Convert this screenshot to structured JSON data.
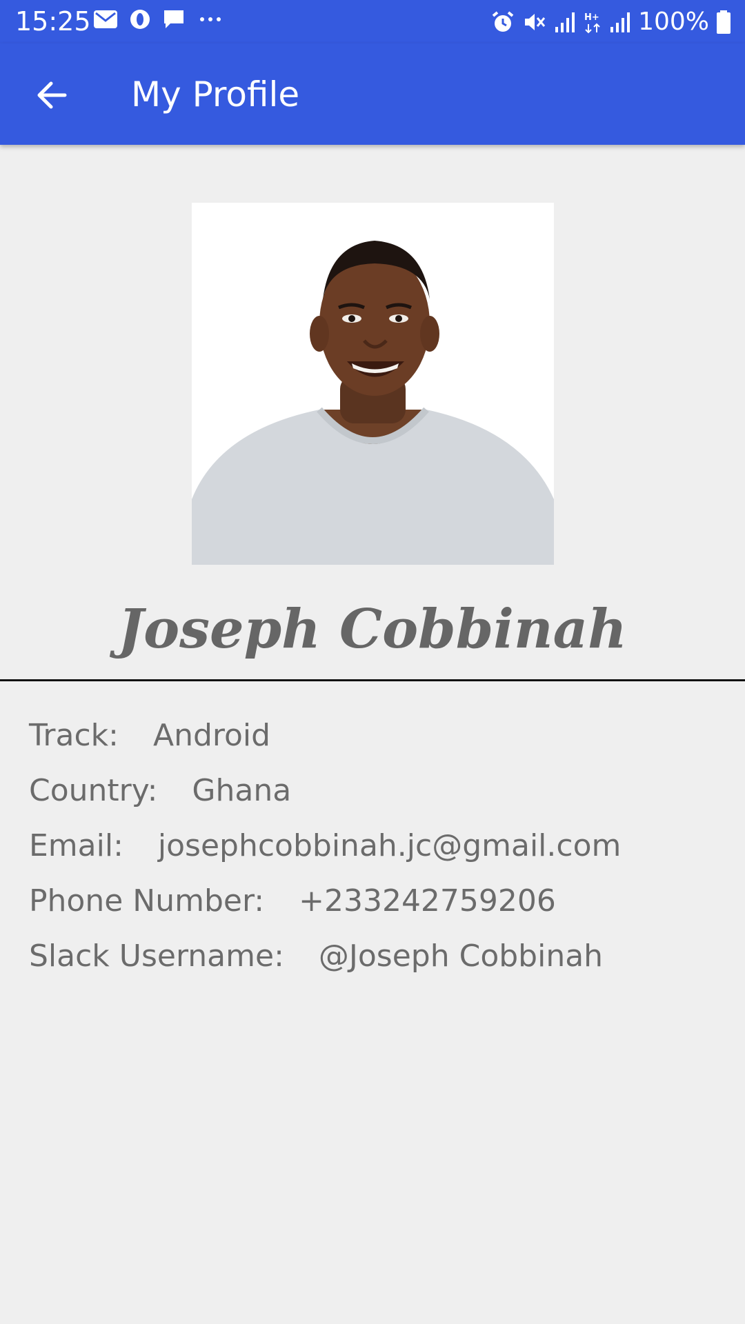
{
  "status_bar": {
    "time": "15:25",
    "battery": "100%",
    "left_icons": [
      "gmail-icon",
      "opera-icon",
      "message-icon",
      "more-dots-icon"
    ],
    "right_icons": [
      "alarm-icon",
      "mute-icon",
      "signal-icon",
      "data-hplus-icon",
      "signal-icon",
      "battery-icon"
    ]
  },
  "app_bar": {
    "title": "My Profile",
    "back_icon": "arrow-back-icon",
    "color": "#355adf"
  },
  "profile": {
    "name": "Joseph Cobbinah",
    "fields": [
      {
        "label": "Track:",
        "value": "Android"
      },
      {
        "label": "Country:",
        "value": "Ghana"
      },
      {
        "label": "Email:",
        "value": "josephcobbinah.jc@gmail.com"
      },
      {
        "label": "Phone Number:",
        "value": "+233242759206"
      },
      {
        "label": "Slack Username:",
        "value": "@Joseph Cobbinah"
      }
    ]
  }
}
